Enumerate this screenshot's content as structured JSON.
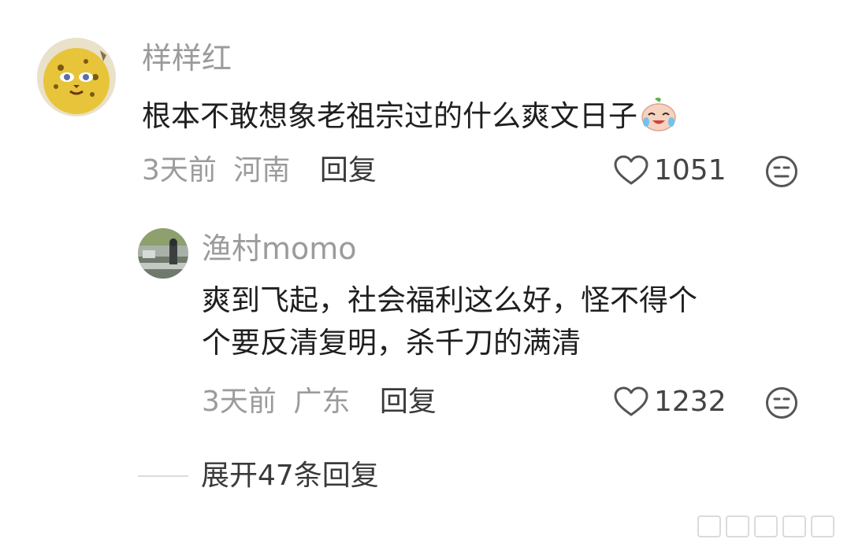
{
  "comment": {
    "username": "样样红",
    "text": "根本不敢想象老祖宗过的什么爽文日子",
    "emoji": "crying-laughing-emoji",
    "time": "3天前",
    "location": "河南",
    "reply_label": "回复",
    "likes": "1051"
  },
  "reply": {
    "username": "渔村momo",
    "text_line1": "爽到飞起，社会福利这么好，怪不得个",
    "text_line2": "个要反清复明，杀千刀的满清",
    "time": "3天前",
    "location": "广东",
    "reply_label": "回复",
    "likes": "1232"
  },
  "expand_replies_label": "展开47条回复",
  "colors": {
    "meta_gray": "#9b9b9b",
    "text_dark": "#1f1f1f",
    "icon_gray": "#555555"
  }
}
